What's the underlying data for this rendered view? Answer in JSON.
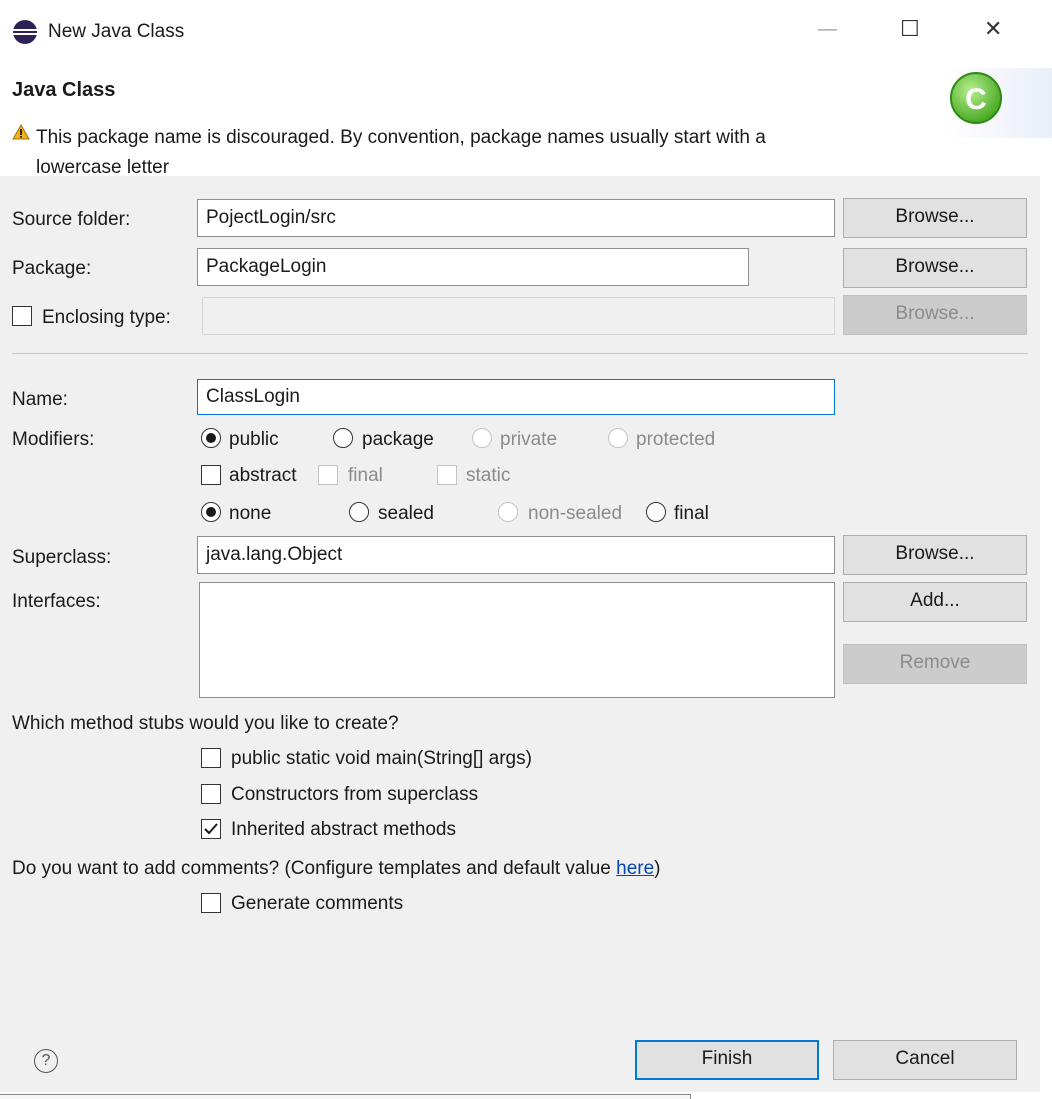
{
  "window": {
    "title": "New Java Class",
    "minimize": "—",
    "maximize": "☐",
    "close": "✕"
  },
  "header": {
    "title": "Java Class",
    "warning_line1": "This package name is discouraged. By convention, package names usually start with a",
    "warning_line2": "lowercase letter",
    "badge_letter": "C"
  },
  "form": {
    "source_folder_label": "Source folder:",
    "source_folder_value": "PojectLogin/src",
    "package_label": "Package:",
    "package_value": "PackageLogin",
    "enclosing_type_label": "Enclosing type:",
    "enclosing_type_value": "",
    "browse": "Browse...",
    "name_label": "Name:",
    "name_value": "ClassLogin",
    "modifiers_label": "Modifiers:",
    "mod_public": "public",
    "mod_package": "package",
    "mod_private": "private",
    "mod_protected": "protected",
    "mod_abstract": "abstract",
    "mod_final": "final",
    "mod_static": "static",
    "seal_none": "none",
    "seal_sealed": "sealed",
    "seal_non_sealed": "non-sealed",
    "seal_final": "final",
    "superclass_label": "Superclass:",
    "superclass_value": "java.lang.Object",
    "interfaces_label": "Interfaces:",
    "add": "Add...",
    "remove": "Remove"
  },
  "stubs": {
    "question": "Which method stubs would you like to create?",
    "main": "public static void main(String[] args)",
    "constructors": "Constructors from superclass",
    "inherited": "Inherited abstract methods",
    "inherited_checked": true
  },
  "comments": {
    "question_prefix": "Do you want to add comments? (Configure templates and default value ",
    "link": "here",
    "question_suffix": ")",
    "generate": "Generate comments"
  },
  "footer": {
    "help": "?",
    "finish": "Finish",
    "cancel": "Cancel"
  },
  "colors": {
    "accent": "#0078d7",
    "warning": "#e8a317",
    "badge": "#4caf28"
  }
}
